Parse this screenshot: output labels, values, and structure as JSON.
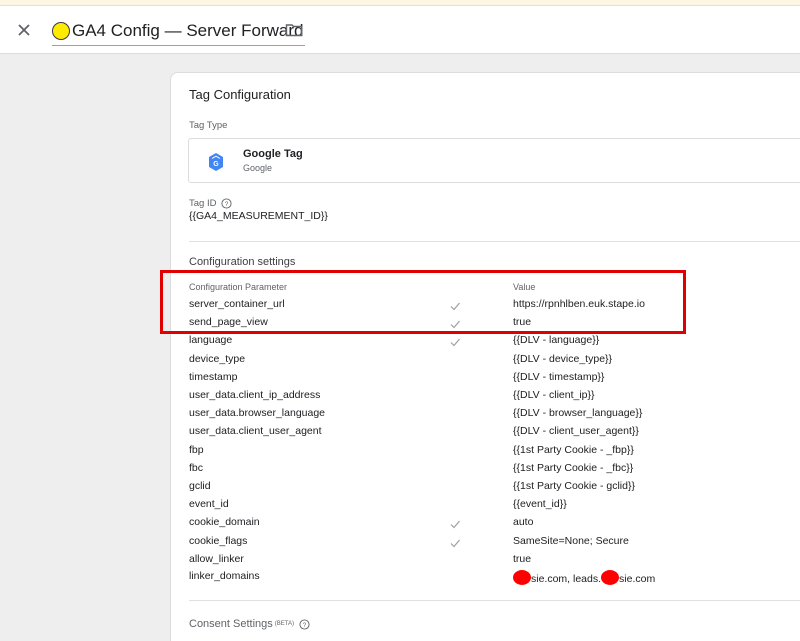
{
  "header": {
    "title": "GA4 Config — Server Forward",
    "close_icon": "close-icon",
    "folder_icon": "folder-icon",
    "indicator_color": "#ffeb00"
  },
  "tag_config": {
    "section_title": "Tag Configuration",
    "tag_type_label": "Tag Type",
    "tag_type_name": "Google Tag",
    "tag_type_sub": "Google",
    "tag_id_label": "Tag ID",
    "tag_id_value": "{{GA4_MEASUREMENT_ID}}",
    "config_settings_title": "Configuration settings",
    "col_param": "Configuration Parameter",
    "col_value": "Value",
    "rows": [
      {
        "param": "server_container_url",
        "checked": true,
        "value": "https://rpnhlben.euk.stape.io"
      },
      {
        "param": "send_page_view",
        "checked": true,
        "value": "true"
      },
      {
        "param": "language",
        "checked": true,
        "value": "{{DLV - language}}"
      },
      {
        "param": "device_type",
        "checked": false,
        "value": "{{DLV - device_type}}"
      },
      {
        "param": "timestamp",
        "checked": false,
        "value": "{{DLV - timestamp}}"
      },
      {
        "param": "user_data.client_ip_address",
        "checked": false,
        "value": "{{DLV - client_ip}}"
      },
      {
        "param": "user_data.browser_language",
        "checked": false,
        "value": "{{DLV - browser_language}}"
      },
      {
        "param": "user_data.client_user_agent",
        "checked": false,
        "value": "{{DLV - client_user_agent}}"
      },
      {
        "param": "fbp",
        "checked": false,
        "value": "{{1st Party Cookie - _fbp}}"
      },
      {
        "param": "fbc",
        "checked": false,
        "value": "{{1st Party Cookie - _fbc}}"
      },
      {
        "param": "gclid",
        "checked": false,
        "value": "{{1st Party Cookie - gclid}}"
      },
      {
        "param": "event_id",
        "checked": false,
        "value": "{{event_id}}"
      },
      {
        "param": "cookie_domain",
        "checked": true,
        "value": "auto"
      },
      {
        "param": "cookie_flags",
        "checked": true,
        "value": "SameSite=None; Secure"
      },
      {
        "param": "allow_linker",
        "checked": false,
        "value": "true"
      }
    ],
    "linker_row": {
      "param": "linker_domains",
      "checked": false,
      "value_part1": "sie.com, leads.",
      "value_part2": "sie.com"
    },
    "consent_title": "Consent Settings",
    "consent_beta": "(BETA)"
  },
  "colors": {
    "highlight": "#e00000",
    "redaction": "#ff0000",
    "check": "#9aa0a6",
    "gtag_blue": "#4285f4"
  }
}
